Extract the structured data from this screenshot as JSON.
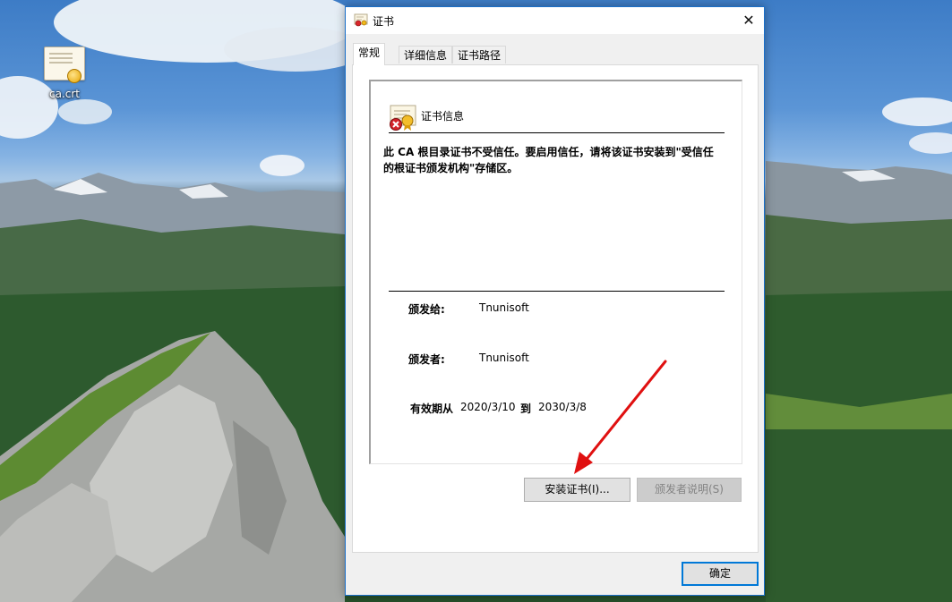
{
  "desktop": {
    "icon": {
      "label": "ca.crt",
      "icon_name": "certificate-file-icon"
    }
  },
  "dialog": {
    "title": "证书",
    "close_glyph": "✕",
    "tabs": [
      {
        "label": "常规",
        "active": true
      },
      {
        "label": "详细信息",
        "active": false
      },
      {
        "label": "证书路径",
        "active": false
      }
    ],
    "info": {
      "header": "证书信息",
      "warning": "此 CA 根目录证书不受信任。要启用信任，请将该证书安装到\"受信任的根证书颁发机构\"存储区。",
      "issued_to_label": "颁发给:",
      "issued_to_value": "Tnunisoft",
      "issued_by_label": "颁发者:",
      "issued_by_value": "Tnunisoft",
      "valid_from_label": "有效期从",
      "valid_from_value": "2020/3/10",
      "valid_to_label": "到",
      "valid_to_value": "2030/3/8"
    },
    "buttons": {
      "install": "安装证书(I)...",
      "issuer_statement": "颁发者说明(S)",
      "ok": "确定"
    }
  },
  "colors": {
    "accent": "#0078d7",
    "annotation_arrow": "#e01010"
  }
}
